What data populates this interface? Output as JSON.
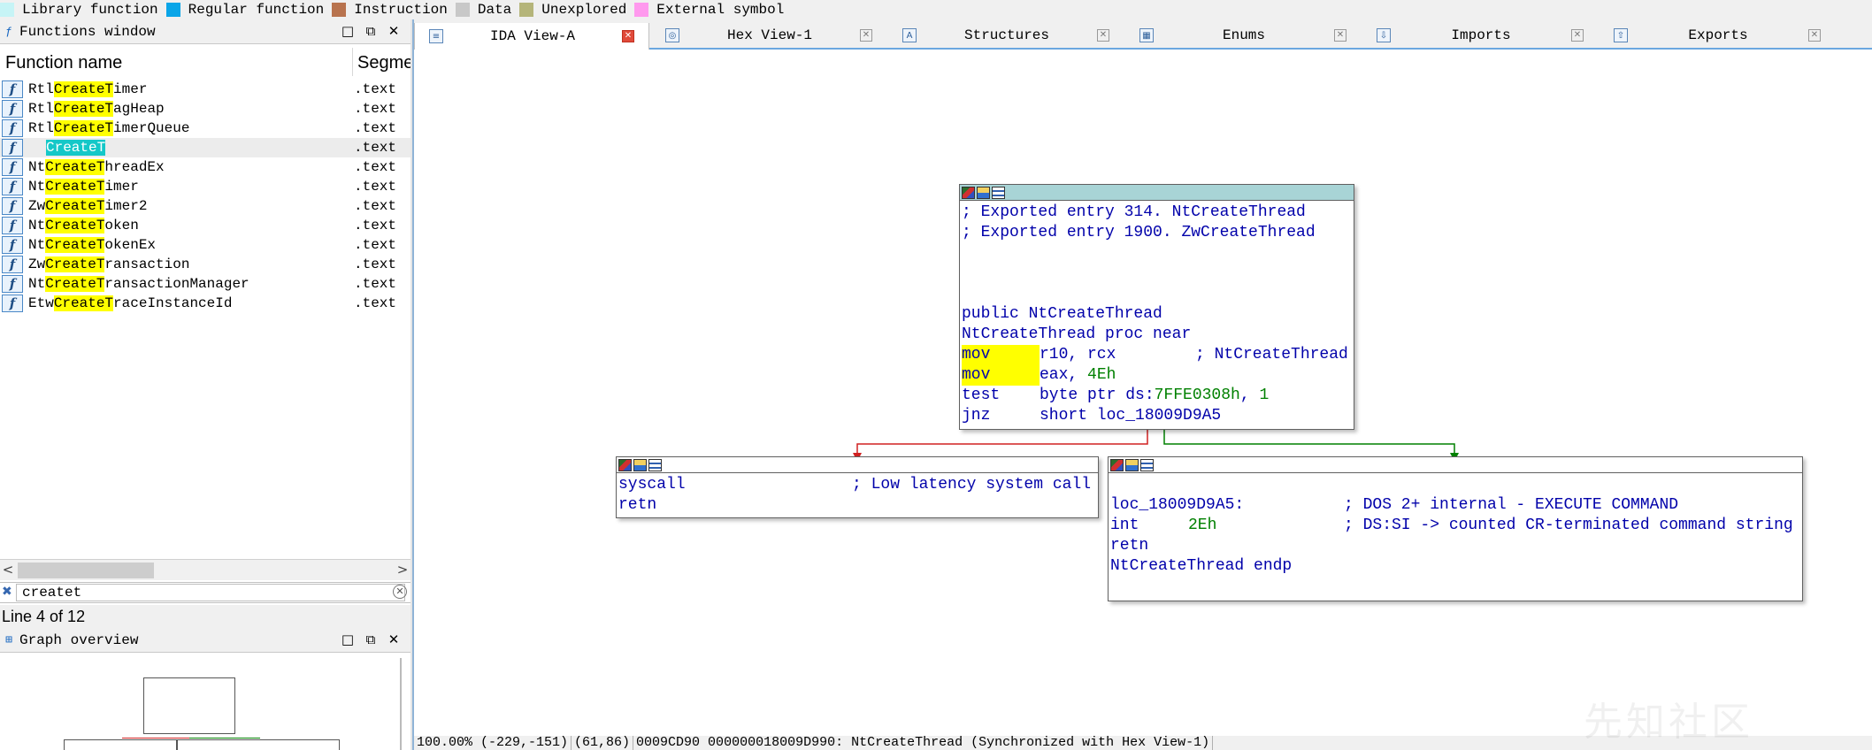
{
  "legend": [
    {
      "label": "Library function",
      "color": "#c6f4f6"
    },
    {
      "label": "Regular function",
      "color": "#0aa5e8"
    },
    {
      "label": "Instruction",
      "color": "#b8734e"
    },
    {
      "label": "Data",
      "color": "#c8c8c8"
    },
    {
      "label": "Unexplored",
      "color": "#b5b57a"
    },
    {
      "label": "External symbol",
      "color": "#ff99ee"
    }
  ],
  "functions_window": {
    "title": "Functions window",
    "columns": {
      "name": "Function name",
      "segment": "Segme"
    },
    "rows": [
      {
        "prefix": "Rtl",
        "match": "CreateT",
        "suffix": "imer",
        "segment": ".text"
      },
      {
        "prefix": "Rtl",
        "match": "CreateT",
        "suffix": "agHeap",
        "segment": ".text"
      },
      {
        "prefix": "Rtl",
        "match": "CreateT",
        "suffix": "imerQueue",
        "segment": ".text"
      },
      {
        "prefix": "",
        "match": "CreateT",
        "suffix": "",
        "segment": ".text"
      },
      {
        "prefix": "Nt",
        "match": "CreateT",
        "suffix": "hreadEx",
        "segment": ".text"
      },
      {
        "prefix": "Nt",
        "match": "CreateT",
        "suffix": "imer",
        "segment": ".text"
      },
      {
        "prefix": "Zw",
        "match": "CreateT",
        "suffix": "imer2",
        "segment": ".text"
      },
      {
        "prefix": "Nt",
        "match": "CreateT",
        "suffix": "oken",
        "segment": ".text"
      },
      {
        "prefix": "Nt",
        "match": "CreateT",
        "suffix": "okenEx",
        "segment": ".text"
      },
      {
        "prefix": "Zw",
        "match": "CreateT",
        "suffix": "ransaction",
        "segment": ".text"
      },
      {
        "prefix": "Nt",
        "match": "CreateT",
        "suffix": "ransactionManager",
        "segment": ".text"
      },
      {
        "prefix": "Etw",
        "match": "CreateT",
        "suffix": "raceInstanceId",
        "segment": ".text"
      }
    ],
    "filter_value": "createt",
    "line_info": "Line 4 of 12"
  },
  "graph_overview": {
    "title": "Graph overview"
  },
  "tabs": [
    {
      "label": "IDA View-A",
      "icon": "ida-view-icon",
      "active": true
    },
    {
      "label": "Hex View-1",
      "icon": "hex-view-icon",
      "active": false
    },
    {
      "label": "Structures",
      "icon": "structures-icon",
      "active": false
    },
    {
      "label": "Enums",
      "icon": "enums-icon",
      "active": false
    },
    {
      "label": "Imports",
      "icon": "imports-icon",
      "active": false
    },
    {
      "label": "Exports",
      "icon": "exports-icon",
      "active": false
    }
  ],
  "graph": {
    "entry_block": {
      "comments": [
        "; Exported entry 314. NtCreateThread",
        "; Exported entry 1900. ZwCreateThread"
      ],
      "public_line": "public NtCreateThread",
      "proc_line": "NtCreateThread proc near",
      "instructions": [
        {
          "mnemonic": "mov",
          "operands": "r10, rcx",
          "comment": "; NtCreateThread",
          "highlight": true
        },
        {
          "mnemonic": "mov",
          "operands": "eax, ",
          "imm": "4Eh",
          "comment": "",
          "highlight": true
        },
        {
          "mnemonic": "test",
          "operands": "byte ptr ds:",
          "imm": "7FFE0308h",
          "tail": ", ",
          "imm2": "1",
          "comment": "",
          "highlight": false
        },
        {
          "mnemonic": "jnz",
          "operands": "short loc_18009D9A5",
          "comment": "",
          "highlight": false
        }
      ]
    },
    "left_block": {
      "lines": [
        {
          "mnemonic": "syscall",
          "comment": "; Low latency system call"
        },
        {
          "mnemonic": "retn",
          "comment": ""
        }
      ]
    },
    "right_block": {
      "label": "loc_18009D9A5:",
      "label_comment": "; DOS 2+ internal - EXECUTE COMMAND",
      "int_mnemonic": "int",
      "int_operand": "2Eh",
      "int_comment": "; DS:SI -> counted CR-terminated command string",
      "retn": "retn",
      "endp": "NtCreateThread endp"
    },
    "edge_colors": {
      "false_branch": "#d02020",
      "true_branch": "#008000"
    }
  },
  "status_bar": [
    "100.00% (-229,-151)",
    "(61,86)",
    "0009CD90 000000018009D990: NtCreateThread (Synchronized with Hex View-1)"
  ],
  "watermark": "先知社区"
}
